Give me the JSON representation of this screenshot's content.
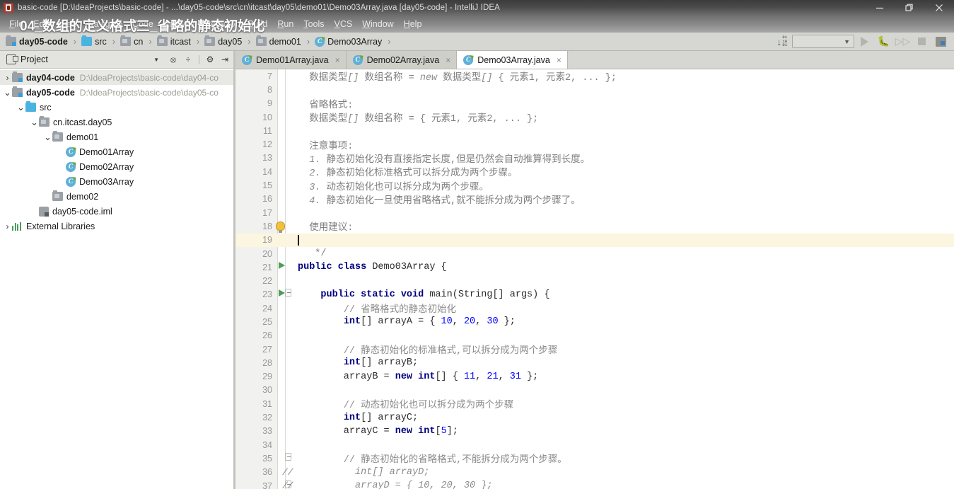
{
  "window": {
    "title": "basic-code [D:\\IdeaProjects\\basic-code] - ...\\day05-code\\src\\cn\\itcast\\day05\\demo01\\Demo03Array.java [day05-code] - IntelliJ IDEA",
    "app_icon": "intellij-idea-icon",
    "controls": {
      "minimize": "minimize-icon",
      "maximize": "restore-icon",
      "close": "close-icon"
    }
  },
  "overlay": {
    "caption": "04_数组的定义格式三_省略的静态初始化"
  },
  "menubar": {
    "items": [
      {
        "label": "File"
      },
      {
        "label": "Edit"
      },
      {
        "label": "View"
      },
      {
        "label": "Navigate"
      },
      {
        "label": "Code"
      },
      {
        "label": "Analyze"
      },
      {
        "label": "Refactor"
      },
      {
        "label": "Build"
      },
      {
        "label": "Run"
      },
      {
        "label": "Tools"
      },
      {
        "label": "VCS"
      },
      {
        "label": "Window"
      },
      {
        "label": "Help"
      }
    ]
  },
  "breadcrumb": {
    "items": [
      {
        "label": "day05-code",
        "icon": "module-folder-icon",
        "bold": true
      },
      {
        "label": "src",
        "icon": "source-folder-icon",
        "bold": false
      },
      {
        "label": "cn",
        "icon": "package-folder-icon",
        "bold": false
      },
      {
        "label": "itcast",
        "icon": "package-folder-icon",
        "bold": false
      },
      {
        "label": "day05",
        "icon": "package-folder-icon",
        "bold": false
      },
      {
        "label": "demo01",
        "icon": "package-folder-icon",
        "bold": false
      },
      {
        "label": "Demo03Array",
        "icon": "java-class-icon",
        "bold": false
      }
    ],
    "separator": "›"
  },
  "run_toolbar": {
    "binary_icon": "download-binary-icon",
    "binary_bits": [
      "01",
      "10",
      "01"
    ],
    "run_config_value": "",
    "run_config_placeholder": "",
    "buttons": [
      {
        "name": "run-button",
        "label": "Run"
      },
      {
        "name": "debug-button",
        "label": "Debug"
      },
      {
        "name": "run-with-coverage-button",
        "label": "Run with Coverage"
      },
      {
        "name": "stop-button",
        "label": "Stop"
      },
      {
        "name": "layout-button",
        "label": "Layout"
      }
    ]
  },
  "project_panel": {
    "icon": "project-tool-window-icon",
    "title": "Project",
    "caret": "▼",
    "tools": [
      {
        "name": "locate-icon",
        "glyph": "⊕"
      },
      {
        "name": "collapse-all-icon",
        "glyph": "÷"
      },
      {
        "name": "settings-gear-icon",
        "glyph": "⚙"
      },
      {
        "name": "hide-panel-icon",
        "glyph": "⇥"
      }
    ],
    "tree": [
      {
        "indent": 0,
        "twisty": "›",
        "icon": "module-folder-icon",
        "label": "day04-code",
        "bold": true,
        "path": "D:\\IdeaProjects\\basic-code\\day04-co",
        "selected": true
      },
      {
        "indent": 0,
        "twisty": "⌄",
        "icon": "module-folder-icon",
        "label": "day05-code",
        "bold": true,
        "path": "D:\\IdeaProjects\\basic-code\\day05-co",
        "selected": false
      },
      {
        "indent": 1,
        "twisty": "⌄",
        "icon": "source-folder-icon",
        "label": "src",
        "bold": false,
        "path": "",
        "selected": false
      },
      {
        "indent": 2,
        "twisty": "⌄",
        "icon": "package-folder-icon",
        "label": "cn.itcast.day05",
        "bold": false,
        "path": "",
        "selected": false
      },
      {
        "indent": 3,
        "twisty": "⌄",
        "icon": "package-folder-icon",
        "label": "demo01",
        "bold": false,
        "path": "",
        "selected": false
      },
      {
        "indent": 4,
        "twisty": "",
        "icon": "java-class-icon",
        "label": "Demo01Array",
        "bold": false,
        "path": "",
        "selected": false
      },
      {
        "indent": 4,
        "twisty": "",
        "icon": "java-class-icon",
        "label": "Demo02Array",
        "bold": false,
        "path": "",
        "selected": false
      },
      {
        "indent": 4,
        "twisty": "",
        "icon": "java-class-icon",
        "label": "Demo03Array",
        "bold": false,
        "path": "",
        "selected": false
      },
      {
        "indent": 3,
        "twisty": "",
        "icon": "package-folder-icon",
        "label": "demo02",
        "bold": false,
        "path": "",
        "selected": false
      },
      {
        "indent": 2,
        "twisty": "",
        "icon": "iml-file-icon",
        "label": "day05-code.iml",
        "bold": false,
        "path": "",
        "selected": false
      },
      {
        "indent": 0,
        "twisty": "›",
        "icon": "external-libraries-icon",
        "label": "External Libraries",
        "bold": false,
        "path": "",
        "selected": false
      }
    ]
  },
  "editor_tabs": [
    {
      "label": "Demo01Array.java",
      "icon": "java-class-icon",
      "active": false,
      "close": "×"
    },
    {
      "label": "Demo02Array.java",
      "icon": "java-class-icon",
      "active": false,
      "close": "×"
    },
    {
      "label": "Demo03Array.java",
      "icon": "java-class-icon",
      "active": true,
      "close": "×"
    }
  ],
  "editor": {
    "first_line_number": 7,
    "current_line": 19,
    "caret_line": 19,
    "lines": [
      {
        "n": 7,
        "gutter": "",
        "gcmt": "",
        "indent": 1,
        "tokens": [
          {
            "t": "  数据类型",
            "c": "doc"
          },
          {
            "t": "[]",
            "c": "cmt-i"
          },
          {
            "t": " 数组名称 = ",
            "c": "doc"
          },
          {
            "t": "new",
            "c": "cmt-i"
          },
          {
            "t": " 数据类型",
            "c": "doc"
          },
          {
            "t": "[]",
            "c": "cmt-i"
          },
          {
            "t": " { 元素1, 元素2, ... };",
            "c": "doc"
          }
        ]
      },
      {
        "n": 8,
        "gutter": "",
        "gcmt": "",
        "indent": 1,
        "tokens": []
      },
      {
        "n": 9,
        "gutter": "",
        "gcmt": "",
        "indent": 1,
        "tokens": [
          {
            "t": "  省略格式:",
            "c": "doc"
          }
        ]
      },
      {
        "n": 10,
        "gutter": "",
        "gcmt": "",
        "indent": 1,
        "tokens": [
          {
            "t": "  数据类型",
            "c": "doc"
          },
          {
            "t": "[]",
            "c": "cmt-i"
          },
          {
            "t": " 数组名称 = { 元素1, 元素2, ... };",
            "c": "doc"
          }
        ]
      },
      {
        "n": 11,
        "gutter": "",
        "gcmt": "",
        "indent": 1,
        "tokens": []
      },
      {
        "n": 12,
        "gutter": "",
        "gcmt": "",
        "indent": 1,
        "tokens": [
          {
            "t": "  注意事项:",
            "c": "doc"
          }
        ]
      },
      {
        "n": 13,
        "gutter": "",
        "gcmt": "",
        "indent": 1,
        "tokens": [
          {
            "t": "  1.",
            "c": "cmt-i"
          },
          {
            "t": " 静态初始化没有直接指定长度,但是仍然会自动推算得到长度。",
            "c": "doc"
          }
        ]
      },
      {
        "n": 14,
        "gutter": "",
        "gcmt": "",
        "indent": 1,
        "tokens": [
          {
            "t": "  2.",
            "c": "cmt-i"
          },
          {
            "t": " 静态初始化标准格式可以拆分成为两个步骤。",
            "c": "doc"
          }
        ]
      },
      {
        "n": 15,
        "gutter": "",
        "gcmt": "",
        "indent": 1,
        "tokens": [
          {
            "t": "  3.",
            "c": "cmt-i"
          },
          {
            "t": " 动态初始化也可以拆分成为两个步骤。",
            "c": "doc"
          }
        ]
      },
      {
        "n": 16,
        "gutter": "",
        "gcmt": "",
        "indent": 1,
        "tokens": [
          {
            "t": "  4.",
            "c": "cmt-i"
          },
          {
            "t": " 静态初始化一旦使用省略格式,就不能拆分成为两个步骤了。",
            "c": "doc"
          }
        ]
      },
      {
        "n": 17,
        "gutter": "",
        "gcmt": "",
        "indent": 1,
        "tokens": []
      },
      {
        "n": 18,
        "gutter": "",
        "gcmt": "",
        "indent": 1,
        "tokens": [
          {
            "t": "  使用建议:",
            "c": "doc"
          }
        ]
      },
      {
        "n": 19,
        "gutter": "",
        "gcmt": "",
        "indent": 1,
        "tokens": []
      },
      {
        "n": 20,
        "gutter": "",
        "gcmt": "",
        "indent": 1,
        "tokens": [
          {
            "t": "   */",
            "c": "doc"
          }
        ]
      },
      {
        "n": 21,
        "gutter": "run",
        "gcmt": "",
        "indent": 0,
        "tokens": [
          {
            "t": "public class",
            "c": "kw"
          },
          {
            "t": " Demo03Array {",
            "c": "pln"
          }
        ]
      },
      {
        "n": 22,
        "gutter": "",
        "gcmt": "",
        "indent": 0,
        "tokens": []
      },
      {
        "n": 23,
        "gutter": "run-fold",
        "gcmt": "",
        "indent": 0,
        "tokens": [
          {
            "t": "    ",
            "c": "pln"
          },
          {
            "t": "public static void",
            "c": "kw"
          },
          {
            "t": " main(String[] args) {",
            "c": "pln"
          }
        ]
      },
      {
        "n": 24,
        "gutter": "",
        "gcmt": "",
        "indent": 0,
        "tokens": [
          {
            "t": "        // 省略格式的静态初始化",
            "c": "cmt"
          }
        ]
      },
      {
        "n": 25,
        "gutter": "",
        "gcmt": "",
        "indent": 0,
        "tokens": [
          {
            "t": "        ",
            "c": "pln"
          },
          {
            "t": "int",
            "c": "kw"
          },
          {
            "t": "[] arrayA = { ",
            "c": "pln"
          },
          {
            "t": "10",
            "c": "num"
          },
          {
            "t": ", ",
            "c": "pln"
          },
          {
            "t": "20",
            "c": "num"
          },
          {
            "t": ", ",
            "c": "pln"
          },
          {
            "t": "30",
            "c": "num"
          },
          {
            "t": " };",
            "c": "pln"
          }
        ]
      },
      {
        "n": 26,
        "gutter": "",
        "gcmt": "",
        "indent": 0,
        "tokens": []
      },
      {
        "n": 27,
        "gutter": "",
        "gcmt": "",
        "indent": 0,
        "tokens": [
          {
            "t": "        // 静态初始化的标准格式,可以拆分成为两个步骤",
            "c": "cmt"
          }
        ]
      },
      {
        "n": 28,
        "gutter": "",
        "gcmt": "",
        "indent": 0,
        "tokens": [
          {
            "t": "        ",
            "c": "pln"
          },
          {
            "t": "int",
            "c": "kw"
          },
          {
            "t": "[] arrayB;",
            "c": "pln"
          }
        ]
      },
      {
        "n": 29,
        "gutter": "",
        "gcmt": "",
        "indent": 0,
        "tokens": [
          {
            "t": "        arrayB = ",
            "c": "pln"
          },
          {
            "t": "new int",
            "c": "kw"
          },
          {
            "t": "[] { ",
            "c": "pln"
          },
          {
            "t": "11",
            "c": "num"
          },
          {
            "t": ", ",
            "c": "pln"
          },
          {
            "t": "21",
            "c": "num"
          },
          {
            "t": ", ",
            "c": "pln"
          },
          {
            "t": "31",
            "c": "num"
          },
          {
            "t": " };",
            "c": "pln"
          }
        ]
      },
      {
        "n": 30,
        "gutter": "",
        "gcmt": "",
        "indent": 0,
        "tokens": []
      },
      {
        "n": 31,
        "gutter": "",
        "gcmt": "",
        "indent": 0,
        "tokens": [
          {
            "t": "        // 动态初始化也可以拆分成为两个步骤",
            "c": "cmt"
          }
        ]
      },
      {
        "n": 32,
        "gutter": "",
        "gcmt": "",
        "indent": 0,
        "tokens": [
          {
            "t": "        ",
            "c": "pln"
          },
          {
            "t": "int",
            "c": "kw"
          },
          {
            "t": "[] arrayC;",
            "c": "pln"
          }
        ]
      },
      {
        "n": 33,
        "gutter": "",
        "gcmt": "",
        "indent": 0,
        "tokens": [
          {
            "t": "        arrayC = ",
            "c": "pln"
          },
          {
            "t": "new int",
            "c": "kw"
          },
          {
            "t": "[",
            "c": "pln"
          },
          {
            "t": "5",
            "c": "num"
          },
          {
            "t": "];",
            "c": "pln"
          }
        ]
      },
      {
        "n": 34,
        "gutter": "",
        "gcmt": "",
        "indent": 0,
        "tokens": []
      },
      {
        "n": 35,
        "gutter": "fold",
        "gcmt": "",
        "indent": 0,
        "tokens": [
          {
            "t": "        // 静态初始化的省略格式,不能拆分成为两个步骤。",
            "c": "cmt"
          }
        ]
      },
      {
        "n": 36,
        "gutter": "",
        "gcmt": "//",
        "indent": 0,
        "tokens": [
          {
            "t": "          int[] arrayD;",
            "c": "cmt-i"
          }
        ]
      },
      {
        "n": 37,
        "gutter": "fold-end",
        "gcmt": "//",
        "indent": 0,
        "tokens": [
          {
            "t": "          arrayD = { 10, 20, 30 };",
            "c": "cmt-i"
          }
        ]
      }
    ]
  }
}
